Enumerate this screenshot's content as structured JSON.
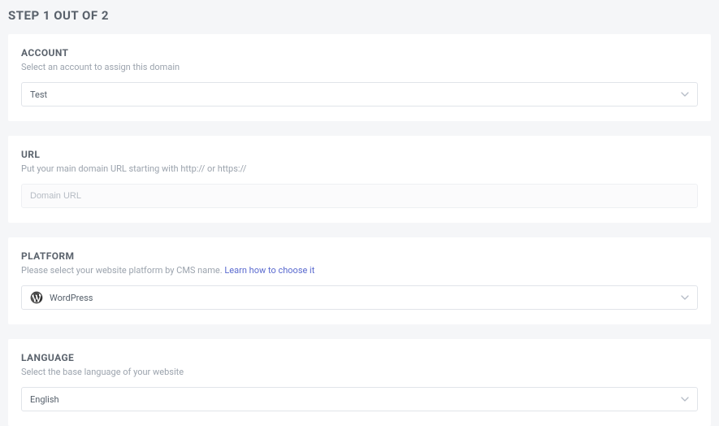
{
  "header": {
    "step_title": "STEP 1 OUT OF 2"
  },
  "account": {
    "label": "ACCOUNT",
    "desc": "Select an account to assign this domain",
    "value": "Test"
  },
  "url": {
    "label": "URL",
    "desc": "Put your main domain URL starting with http:// or https://",
    "placeholder": "Domain URL"
  },
  "platform": {
    "label": "PLATFORM",
    "desc_prefix": "Please select your website platform by CMS name.  ",
    "link_text": "Learn how to choose it",
    "value": "WordPress"
  },
  "language": {
    "label": "LANGUAGE",
    "desc": "Select the base language of your website",
    "value": "English"
  }
}
